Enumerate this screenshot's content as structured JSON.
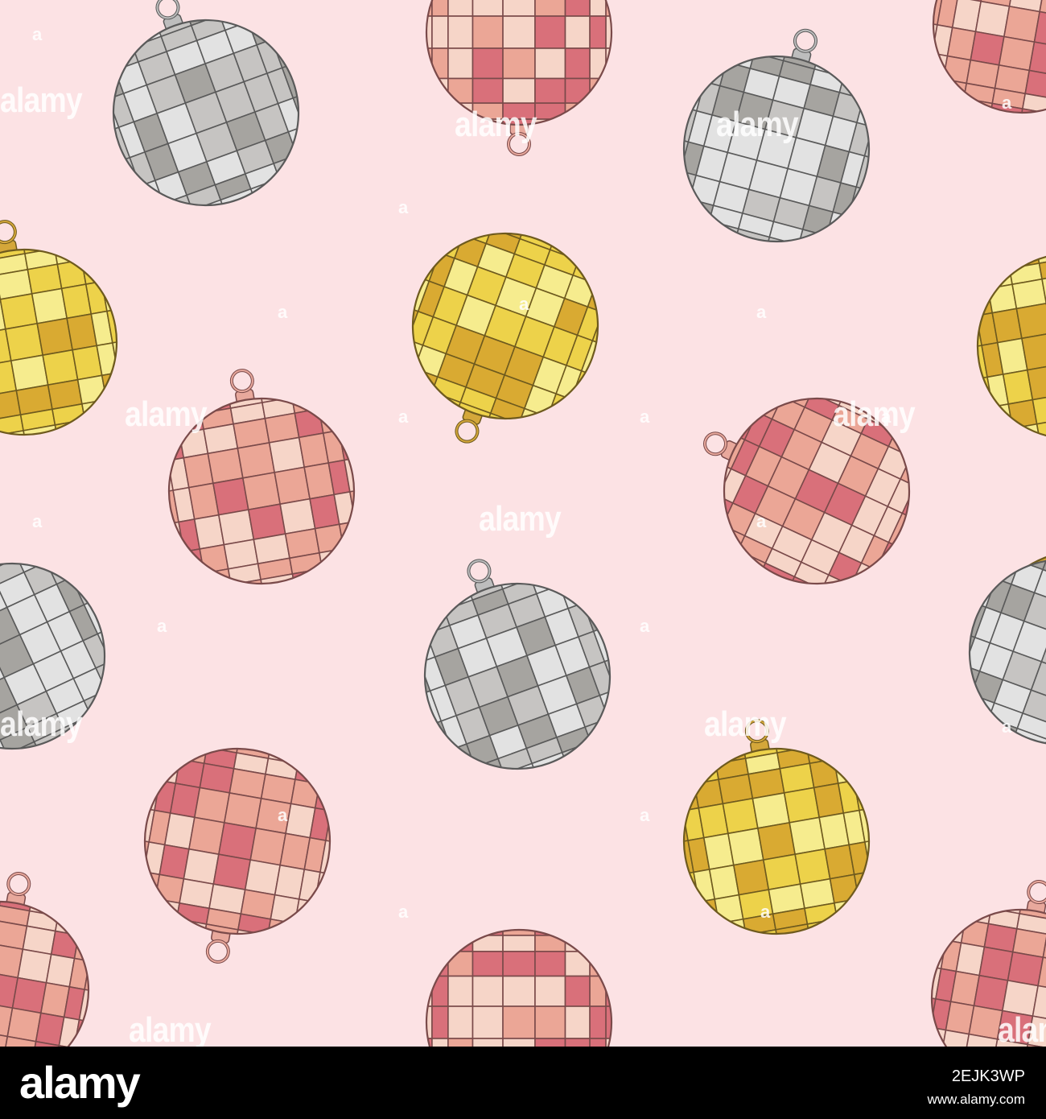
{
  "image": {
    "background_color": "#fce2e4",
    "ornament_styles": {
      "silver": {
        "light": "#e2e2e2",
        "mid": "#c6c4c2",
        "dark": "#a6a4a0",
        "line": "#5a5a5a",
        "cap": "#bdbdbd"
      },
      "gold": {
        "light": "#f6ec8e",
        "mid": "#edd24a",
        "dark": "#d9aa32",
        "line": "#6e5a1e",
        "cap": "#d4a73a"
      },
      "rose": {
        "light": "#f6d5c8",
        "mid": "#eba696",
        "dark": "#d9707a",
        "line": "#7a4a4a",
        "cap": "#e8a89c"
      }
    },
    "ornaments": [
      {
        "style": "silver",
        "hanger": "top"
      },
      {
        "style": "silver",
        "hanger": "top"
      },
      {
        "style": "gold",
        "hanger": "top"
      },
      {
        "style": "gold",
        "hanger": "bottom"
      },
      {
        "style": "rose",
        "hanger": "top"
      },
      {
        "style": "rose",
        "hanger": "left"
      },
      {
        "style": "silver",
        "hanger": "top"
      },
      {
        "style": "gold",
        "hanger": "bottom"
      },
      {
        "style": "gold",
        "hanger": "top"
      },
      {
        "style": "rose",
        "hanger": "bottom"
      },
      {
        "style": "rose",
        "hanger": "bottom"
      },
      {
        "style": "rose",
        "hanger": "bottom"
      },
      {
        "style": "gold",
        "hanger": "top"
      },
      {
        "style": "silver",
        "hanger": "top"
      },
      {
        "style": "silver",
        "hanger": "top"
      },
      {
        "style": "rose",
        "hanger": "top"
      },
      {
        "style": "rose",
        "hanger": "top"
      },
      {
        "style": "rose",
        "hanger": "top"
      }
    ],
    "watermark_text": "alamy",
    "watermark_mark": "a"
  },
  "footer": {
    "logo": "alamy",
    "image_id": "2EJK3WP",
    "url": "www.alamy.com"
  }
}
